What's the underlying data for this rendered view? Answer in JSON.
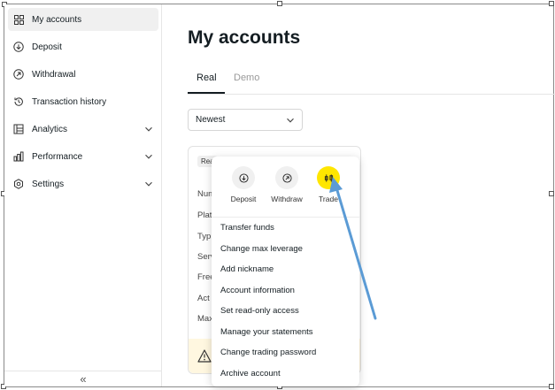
{
  "sidebar": {
    "items": [
      {
        "label": "My accounts",
        "icon": "grid-icon"
      },
      {
        "label": "Deposit",
        "icon": "arrow-down-circle-icon"
      },
      {
        "label": "Withdrawal",
        "icon": "arrow-up-circle-icon"
      },
      {
        "label": "Transaction history",
        "icon": "history-icon"
      },
      {
        "label": "Analytics",
        "icon": "analytics-icon"
      },
      {
        "label": "Performance",
        "icon": "bar-chart-icon"
      },
      {
        "label": "Settings",
        "icon": "gear-icon"
      }
    ],
    "collapse_glyph": "«"
  },
  "main": {
    "title": "My accounts",
    "tabs": [
      {
        "label": "Real"
      },
      {
        "label": "Demo"
      }
    ],
    "sort": {
      "value": "Newest"
    }
  },
  "card": {
    "badge": "Rea",
    "labels": [
      "Num",
      "Plat",
      "Typ",
      "Serv",
      "Free",
      "Act",
      "Max"
    ]
  },
  "menu": {
    "quick_actions": [
      {
        "label": "Deposit",
        "icon": "arrow-down-circle-icon"
      },
      {
        "label": "Withdraw",
        "icon": "arrow-up-circle-icon"
      },
      {
        "label": "Trade",
        "icon": "trade-icon"
      }
    ],
    "items": [
      "Transfer funds",
      "Change max leverage",
      "Add nickname",
      "Account information",
      "Set read-only access",
      "Manage your statements",
      "Change trading password",
      "Archive account"
    ]
  },
  "colors": {
    "accent_yellow": "#ffe600",
    "annotation_arrow": "#5b9bd5",
    "text": "#141d22"
  }
}
